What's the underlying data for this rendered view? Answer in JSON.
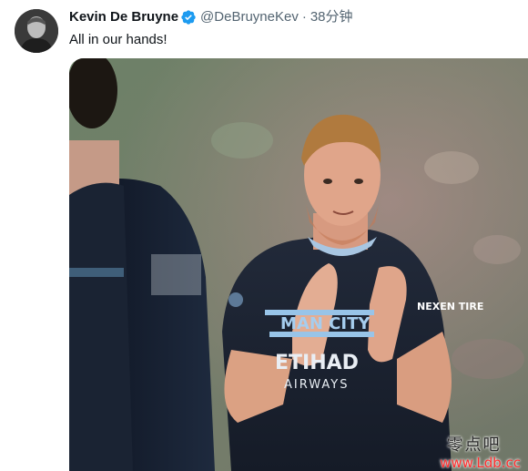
{
  "tweet": {
    "author": {
      "display_name": "Kevin De Bruyne",
      "verified_icon": "verified-badge-icon",
      "handle": "@DeBruyneKev",
      "separator": "·",
      "timestamp": "38分钟"
    },
    "text": "All in our hands!",
    "media": {
      "type": "photo",
      "jersey_text": {
        "club": "MAN CITY",
        "sponsor": "ETIHAD",
        "sponsor_sub": "AIRWAYS",
        "sleeve": "NEXEN TIRE"
      }
    }
  },
  "watermark": {
    "top": "零点吧",
    "bottom": "www.Ldb.cc"
  },
  "colors": {
    "text_primary": "#0f1419",
    "text_secondary": "#536471",
    "verified_blue": "#1d9bf0",
    "watermark_red": "#ff2e2e"
  }
}
